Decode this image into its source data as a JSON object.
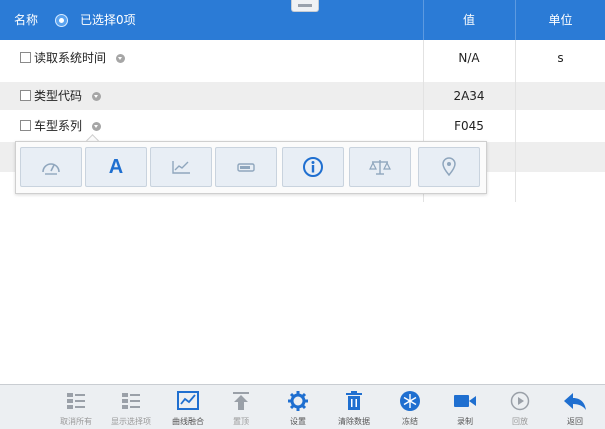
{
  "header": {
    "name_label": "名称",
    "selected_label": "已选择0项",
    "value_label": "值",
    "unit_label": "单位"
  },
  "rows": [
    {
      "label": "读取系统时间",
      "value": "N/A",
      "unit": "s"
    },
    {
      "label": "类型代码",
      "value": "2A34",
      "unit": ""
    },
    {
      "label": "车型系列",
      "value": "F045",
      "unit": ""
    }
  ],
  "popup": {
    "buttons": [
      "gauge-icon",
      "text-icon",
      "line-chart-icon",
      "bar-icon",
      "info-icon",
      "balance-icon",
      "location-icon"
    ],
    "text_glyph": "A"
  },
  "colors": {
    "header_bg": "#2b7bd6",
    "accent": "#1f6fd0",
    "toolbar_bg": "#eceff2"
  },
  "toolbar": {
    "items": [
      {
        "label": "取消所有",
        "icon": "grid-list-icon"
      },
      {
        "label": "显示选择项",
        "icon": "check-list-icon"
      },
      {
        "label": "曲线融合",
        "icon": "chart-merge-icon"
      },
      {
        "label": "置顶",
        "icon": "arrow-up-top-icon"
      },
      {
        "label": "设置",
        "icon": "gear-icon"
      },
      {
        "label": "清除数据",
        "icon": "trash-icon"
      },
      {
        "label": "冻结",
        "icon": "snowflake-icon"
      },
      {
        "label": "录制",
        "icon": "video-camera-icon"
      },
      {
        "label": "回放",
        "icon": "play-icon"
      },
      {
        "label": "返回",
        "icon": "back-arrow-icon"
      }
    ]
  }
}
